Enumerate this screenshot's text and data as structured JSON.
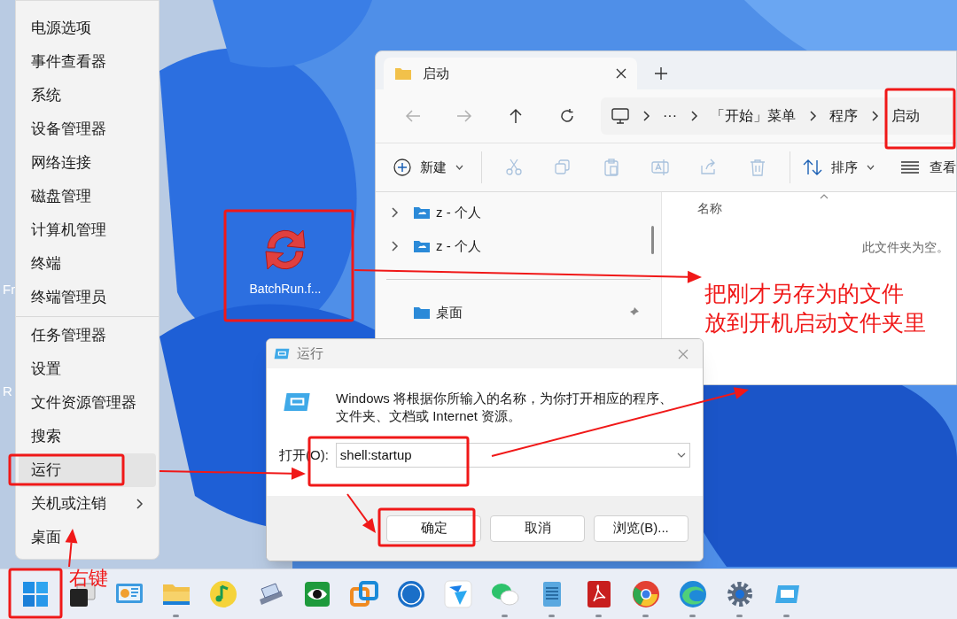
{
  "desktop": {
    "edge_labels": [
      "Fr",
      "R"
    ],
    "icons": [
      {
        "label": "BatchRun.f..."
      }
    ]
  },
  "context_menu": {
    "groups": [
      [
        {
          "label": "电源选项",
          "selected": false,
          "submenu": false
        },
        {
          "label": "事件查看器",
          "selected": false,
          "submenu": false
        },
        {
          "label": "系统",
          "selected": false,
          "submenu": false
        },
        {
          "label": "设备管理器",
          "selected": false,
          "submenu": false
        },
        {
          "label": "网络连接",
          "selected": false,
          "submenu": false
        },
        {
          "label": "磁盘管理",
          "selected": false,
          "submenu": false
        },
        {
          "label": "计算机管理",
          "selected": false,
          "submenu": false
        },
        {
          "label": "终端",
          "selected": false,
          "submenu": false
        },
        {
          "label": "终端管理员",
          "selected": false,
          "submenu": false
        }
      ],
      [
        {
          "label": "任务管理器",
          "selected": false,
          "submenu": false
        },
        {
          "label": "设置",
          "selected": false,
          "submenu": false
        },
        {
          "label": "文件资源管理器",
          "selected": false,
          "submenu": false
        },
        {
          "label": "搜索",
          "selected": false,
          "submenu": false
        },
        {
          "label": "运行",
          "selected": true,
          "submenu": false
        },
        {
          "label": "关机或注销",
          "selected": false,
          "submenu": true
        },
        {
          "label": "桌面",
          "selected": false,
          "submenu": false
        }
      ]
    ]
  },
  "explorer": {
    "tabs": [
      {
        "title": "启动",
        "selected": true
      }
    ],
    "navigation": [
      {
        "disabled": true
      },
      {
        "disabled": true
      },
      {
        "disabled": false
      },
      {
        "disabled": false
      }
    ],
    "breadcrumb": [
      "···",
      "「开始」菜单",
      "程序",
      "启动"
    ],
    "toolbar": {
      "new": "新建",
      "actions": [
        {
          "disabled": true
        },
        {
          "disabled": true
        },
        {
          "disabled": true
        },
        {
          "disabled": true
        },
        {
          "disabled": true
        },
        {
          "disabled": true
        }
      ],
      "sort": "排序",
      "view": "查看"
    },
    "nav_pane": [
      [
        {
          "label": "z - 个人",
          "expanded": false
        },
        {
          "label": "z - 个人",
          "expanded": false
        }
      ],
      [
        {
          "label": "桌面",
          "pinned": true
        }
      ]
    ],
    "columns": [
      "名称"
    ],
    "empty_message": "此文件夹为空。"
  },
  "run_dialog": {
    "title": "运行",
    "description": "Windows 将根据你所输入的名称，为你打开相应的程序、文件夹、文档或 Internet 资源。",
    "open_label": "打开(O):",
    "value": "shell:startup",
    "buttons": [
      "确定",
      "取消",
      "浏览(B)..."
    ]
  },
  "taskbar": {
    "items": [
      {
        "running": false
      },
      {
        "running": false
      },
      {
        "running": false
      },
      {
        "running": true
      },
      {
        "running": false
      },
      {
        "running": false
      },
      {
        "running": false
      },
      {
        "running": false
      },
      {
        "running": false
      },
      {
        "running": false
      },
      {
        "running": true
      },
      {
        "running": true
      },
      {
        "running": true
      },
      {
        "running": true
      },
      {
        "running": true
      },
      {
        "running": true
      },
      {
        "running": true
      }
    ]
  },
  "annotations": {
    "right_click_note": "右键",
    "instruction": [
      "把刚才另存为的文件",
      "放到开机启动文件夹里"
    ]
  }
}
